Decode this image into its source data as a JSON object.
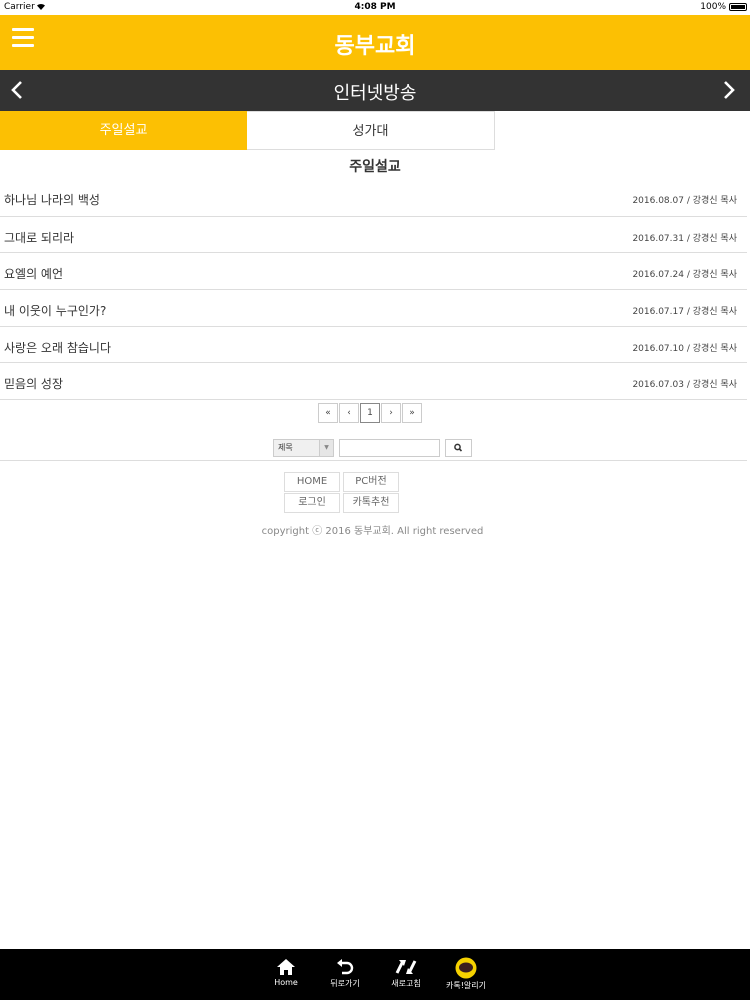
{
  "status_bar": {
    "carrier": "Carrier",
    "time": "4:08 PM",
    "battery": "100%"
  },
  "header": {
    "site_title": "동부교회"
  },
  "subheader": {
    "title": "인터넷방송"
  },
  "tabs": [
    {
      "label": "주일설교",
      "active": true
    },
    {
      "label": "성가대",
      "active": false
    }
  ],
  "section_title": "주일설교",
  "sermons": [
    {
      "title": "하나님 나라의 백성",
      "date": "2016.08.07",
      "preacher": "강경신 목사"
    },
    {
      "title": "그대로 되리라",
      "date": "2016.07.31",
      "preacher": "강경신 목사"
    },
    {
      "title": "요엘의 예언",
      "date": "2016.07.24",
      "preacher": "강경신 목사"
    },
    {
      "title": "내 이웃이 누구인가?",
      "date": "2016.07.17",
      "preacher": "강경신 목사"
    },
    {
      "title": "사랑은 오래 참습니다",
      "date": "2016.07.10",
      "preacher": "강경신 목사"
    },
    {
      "title": "믿음의 성장",
      "date": "2016.07.03",
      "preacher": "강경신 목사"
    }
  ],
  "pagination": {
    "first": "«",
    "prev": "‹",
    "current": "1",
    "next": "›",
    "last": "»"
  },
  "search": {
    "field_selected": "제목",
    "query": ""
  },
  "footer": {
    "links": [
      "HOME",
      "PC버전",
      "로그인",
      "카톡추천"
    ],
    "copyright": "copyright ⓒ 2016 동부교회. All right reserved"
  },
  "bottom_nav": [
    {
      "label": "Home",
      "icon": "home-icon"
    },
    {
      "label": "뒤로가기",
      "icon": "back-icon"
    },
    {
      "label": "새로고침",
      "icon": "refresh-icon"
    },
    {
      "label": "카톡!알리기",
      "icon": "kakaotalk-icon"
    }
  ],
  "colors": {
    "brand": "#fcc003",
    "subbar": "#333333",
    "bottom_bar": "#000000"
  }
}
